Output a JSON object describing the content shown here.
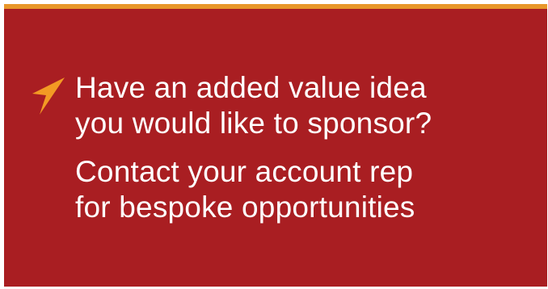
{
  "colors": {
    "panel_background": "#a91e22",
    "top_accent_bar": "#e8972a",
    "icon": "#f39a24",
    "text": "#ffffff"
  },
  "icon": "arrow-pointer-icon",
  "headline": {
    "line1": "Have an added value idea",
    "line2": "you would like to sponsor?"
  },
  "subline": {
    "line1": "Contact your account rep",
    "line2": "for bespoke opportunities"
  }
}
